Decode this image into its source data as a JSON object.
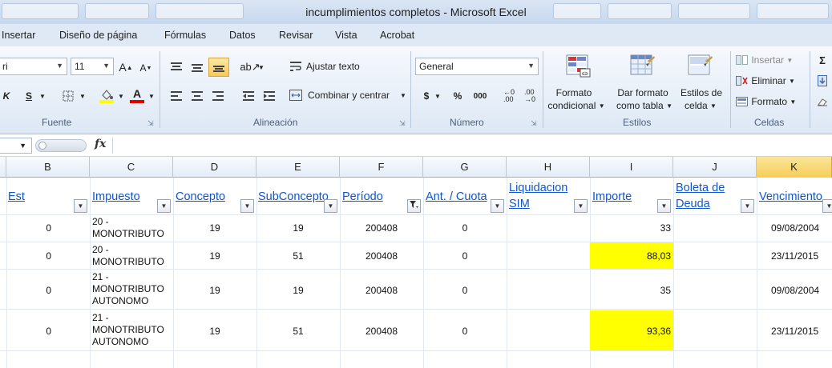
{
  "window": {
    "title": "incumplimientos completos  -  Microsoft Excel"
  },
  "menu": [
    "Insertar",
    "Diseño de página",
    "Fórmulas",
    "Datos",
    "Revisar",
    "Vista",
    "Acrobat"
  ],
  "ribbon": {
    "font": {
      "name_fragment": "ri",
      "size": "11",
      "group": "Fuente",
      "bold_italic": "K",
      "underline": "S",
      "fill_color": "#ffff00",
      "font_color": "#e00000"
    },
    "alignment": {
      "wrap_text": "Ajustar texto",
      "merge_center": "Combinar y centrar",
      "group": "Alineación"
    },
    "number": {
      "format": "General",
      "currency": "$",
      "percent": "%",
      "thousands": "000",
      "group": "Número"
    },
    "styles": {
      "conditional_line1": "Formato",
      "conditional_line2": "condicional",
      "table_line1": "Dar formato",
      "table_line2": "como tabla",
      "cell_line1": "Estilos de",
      "cell_line2": "celda",
      "group": "Estilos"
    },
    "cells": {
      "insert": "Insertar",
      "delete": "Eliminar",
      "format": "Formato",
      "group": "Celdas"
    },
    "editing": {
      "sum": "Σ"
    }
  },
  "formula_bar": {
    "fx": "fx",
    "value": ""
  },
  "columns": [
    "B",
    "C",
    "D",
    "E",
    "F",
    "G",
    "H",
    "I",
    "J",
    "K"
  ],
  "selected_column": "K",
  "headers": {
    "est": "Est",
    "impuesto": "Impuesto",
    "concepto": "Concepto",
    "subconcepto": "SubConcepto",
    "periodo": "Período",
    "ant_cuota": "Ant. / Cuota",
    "liquidacion_1": "Liquidacion",
    "liquidacion_2": "SIM",
    "importe": "Importe",
    "boleta_1": "Boleta de",
    "boleta_2": "Deuda",
    "vencimiento": "Vencimiento"
  },
  "rows": [
    {
      "est": "0",
      "impuesto_1": "20 -",
      "impuesto_2": "MONOTRIBUTO",
      "impuesto_3": "",
      "concepto": "19",
      "subconcepto": "19",
      "periodo": "200408",
      "ant": "0",
      "importe": "33",
      "vencimiento": "09/08/2004",
      "highlight": false
    },
    {
      "est": "0",
      "impuesto_1": "20 -",
      "impuesto_2": "MONOTRIBUTO",
      "impuesto_3": "",
      "concepto": "19",
      "subconcepto": "51",
      "periodo": "200408",
      "ant": "0",
      "importe": "88,03",
      "vencimiento": "23/11/2015",
      "highlight": true
    },
    {
      "est": "0",
      "impuesto_1": "21 -",
      "impuesto_2": "MONOTRIBUTO",
      "impuesto_3": "AUTONOMO",
      "concepto": "19",
      "subconcepto": "19",
      "periodo": "200408",
      "ant": "0",
      "importe": "35",
      "vencimiento": "09/08/2004",
      "highlight": false
    },
    {
      "est": "0",
      "impuesto_1": "21 -",
      "impuesto_2": "MONOTRIBUTO",
      "impuesto_3": "AUTONOMO",
      "concepto": "19",
      "subconcepto": "51",
      "periodo": "200408",
      "ant": "0",
      "importe": "93,36",
      "vencimiento": "23/11/2015",
      "highlight": true
    }
  ],
  "colors": {
    "highlight": "#ffff00",
    "link": "#1155cc",
    "selected_header": "#f6cd56"
  }
}
